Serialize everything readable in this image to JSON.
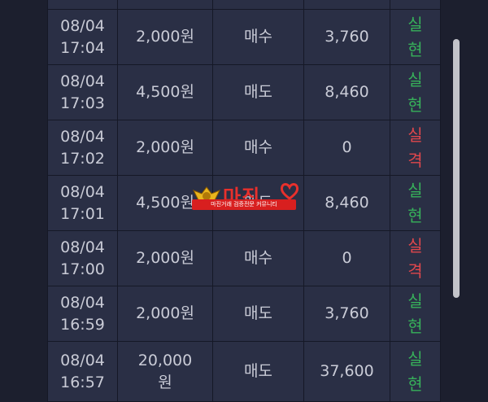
{
  "rows": [
    {
      "date": "08/04",
      "time": "17:04",
      "amount": "2,000원",
      "type": "매수",
      "value": "3,760",
      "result": [
        "실",
        "현"
      ],
      "status": "green"
    },
    {
      "date": "08/04",
      "time": "17:03",
      "amount": "4,500원",
      "type": "매도",
      "value": "8,460",
      "result": [
        "실",
        "현"
      ],
      "status": "green"
    },
    {
      "date": "08/04",
      "time": "17:02",
      "amount": "2,000원",
      "type": "매수",
      "value": "0",
      "result": [
        "실",
        "격"
      ],
      "status": "red"
    },
    {
      "date": "08/04",
      "time": "17:01",
      "amount": "4,500원",
      "type": "매도",
      "value": "8,460",
      "result": [
        "실",
        "현"
      ],
      "status": "green"
    },
    {
      "date": "08/04",
      "time": "17:00",
      "amount": "2,000원",
      "type": "매수",
      "value": "0",
      "result": [
        "실",
        "격"
      ],
      "status": "red"
    },
    {
      "date": "08/04",
      "time": "16:59",
      "amount": "2,000원",
      "type": "매도",
      "value": "3,760",
      "result": [
        "실",
        "현"
      ],
      "status": "green"
    },
    {
      "date": "08/04",
      "time": "16:57",
      "amount_line1": "20,000",
      "amount_line2": "원",
      "type": "매도",
      "value": "37,600",
      "result": [
        "실",
        "현"
      ],
      "status": "green"
    }
  ],
  "logo": {
    "title": "마진",
    "strip": "마진거래 검증전문 커뮤니티"
  },
  "colors": {
    "green": "#37b05a",
    "red": "#e0474c",
    "background": "#1c1f2e",
    "cell": "#2a2f45"
  }
}
